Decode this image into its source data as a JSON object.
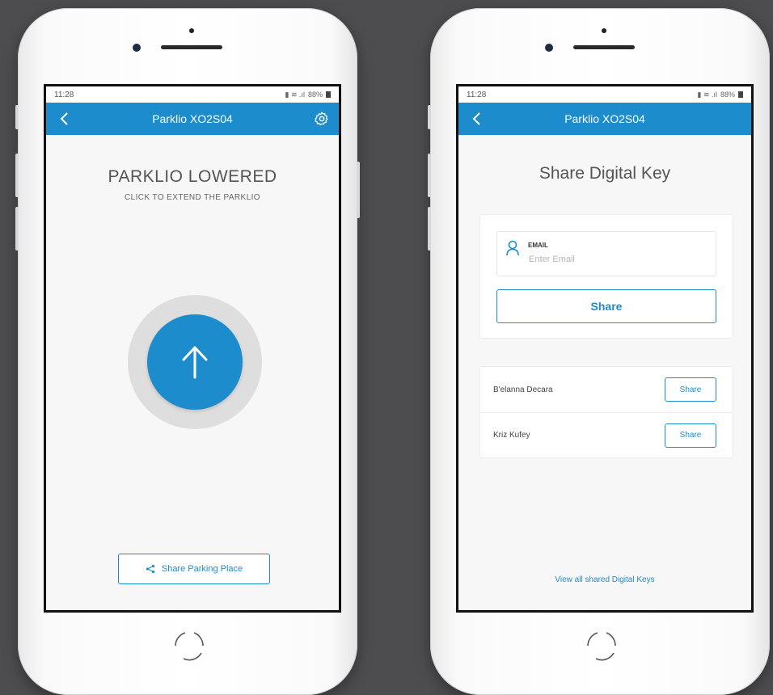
{
  "colors": {
    "accent": "#1d8ccc",
    "background": "#4d4d4f",
    "screen": "#f7f7f8",
    "ring": "#dedede"
  },
  "left_phone": {
    "status_bar": {
      "time": "11:28",
      "battery": "88%"
    },
    "app_bar": {
      "title": "Parklio XO2S04",
      "back_icon": "chevron-left-icon",
      "settings_icon": "gear-icon"
    },
    "status_title": "PARKLIO LOWERED",
    "status_subtitle": "CLICK TO EXTEND THE PARKLIO",
    "extend_icon": "arrow-up-icon",
    "share_parking": {
      "icon": "share-icon",
      "label": "Share Parking Place"
    }
  },
  "right_phone": {
    "status_bar": {
      "time": "11:28",
      "battery": "88%"
    },
    "app_bar": {
      "title": "Parklio XO2S04",
      "back_icon": "chevron-left-icon"
    },
    "title": "Share Digital Key",
    "email": {
      "icon": "user-icon",
      "label": "EMAIL",
      "placeholder": "Enter Email",
      "value": ""
    },
    "share_button": "Share",
    "contacts": [
      {
        "name": "B'elanna Decara",
        "action": "Share"
      },
      {
        "name": "Kriz Kufey",
        "action": "Share"
      }
    ],
    "view_all_link": "View all shared Digital Keys"
  }
}
